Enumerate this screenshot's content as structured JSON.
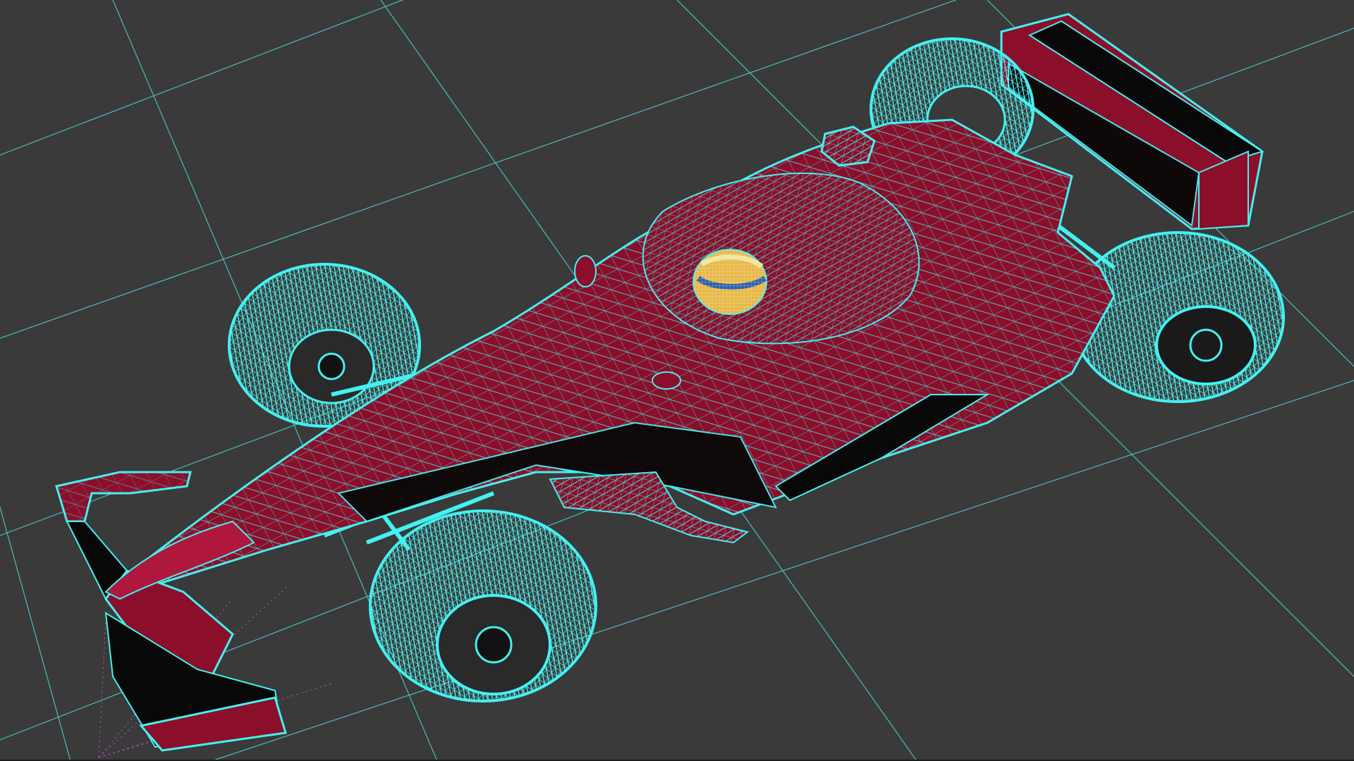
{
  "viewport": {
    "background_color": "#3a3a3a",
    "grid_color": "#4fd3d6",
    "wire_color": "#45f0f0",
    "body_color": "#8b0f2a",
    "shadow_color": "#080808",
    "helmet_colors": [
      "#e8b84a",
      "#2a5fb0",
      "#f0e7a0"
    ],
    "camera_ray_color": "#c04ad0"
  },
  "scene": {
    "subject": "formula-one-car-wireframe",
    "wheels": 4,
    "shading": "wireframe-on-shaded"
  }
}
